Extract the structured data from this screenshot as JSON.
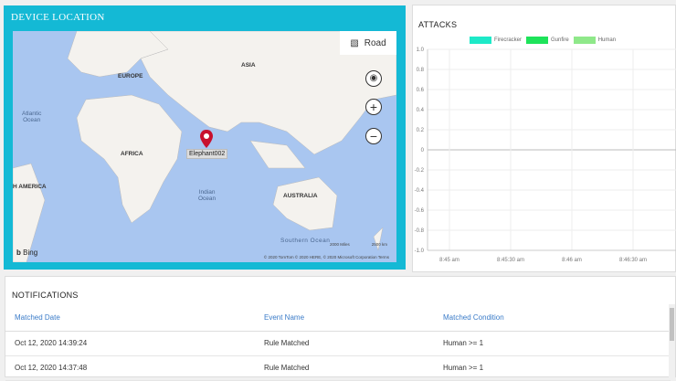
{
  "map_panel": {
    "title": "DEVICE LOCATION",
    "road_label": "Road",
    "bing_label": "Bing",
    "copyright": "© 2020 TomTom © 2020 HERE, © 2020 Microsoft Corporation Terms",
    "scale": [
      "2000 Miles",
      "2500 km"
    ],
    "labels": {
      "asia": "ASIA",
      "europe": "EUROPE",
      "africa": "AFRICA",
      "australia": "AUSTRALIA",
      "america": "H AMERICA",
      "atlantic": "Atlantic\nOcean",
      "indian": "Indian\nOcean",
      "southern": "Southern Ocean"
    },
    "device": {
      "name": "Elephant002"
    }
  },
  "attacks_panel": {
    "title": "ATTACKS"
  },
  "chart_data": {
    "type": "line",
    "title": "ATTACKS",
    "series": [
      {
        "name": "Firecracker",
        "color": "#1de9c8",
        "values": []
      },
      {
        "name": "Gunfire",
        "color": "#1ee35a",
        "values": []
      },
      {
        "name": "Human",
        "color": "#8fe88a",
        "values": []
      }
    ],
    "x_ticks": [
      "8:45 am",
      "8:45:30 am",
      "8:46 am",
      "8:46:30 am"
    ],
    "y_ticks": [
      "1.0",
      "0.8",
      "0.6",
      "0.4",
      "0.2",
      "0",
      "-0.2",
      "-0.4",
      "-0.6",
      "-0.8",
      "-1.0"
    ],
    "ylim": [
      -1,
      1
    ],
    "grid": true,
    "legend": "top"
  },
  "notifications": {
    "title": "NOTIFICATIONS",
    "columns": [
      "Matched Date",
      "Event Name",
      "Matched Condition"
    ],
    "rows": [
      [
        "Oct 12, 2020 14:39:24",
        "Rule Matched",
        "Human >= 1"
      ],
      [
        "Oct 12, 2020 14:37:48",
        "Rule Matched",
        "Human >= 1"
      ]
    ]
  }
}
